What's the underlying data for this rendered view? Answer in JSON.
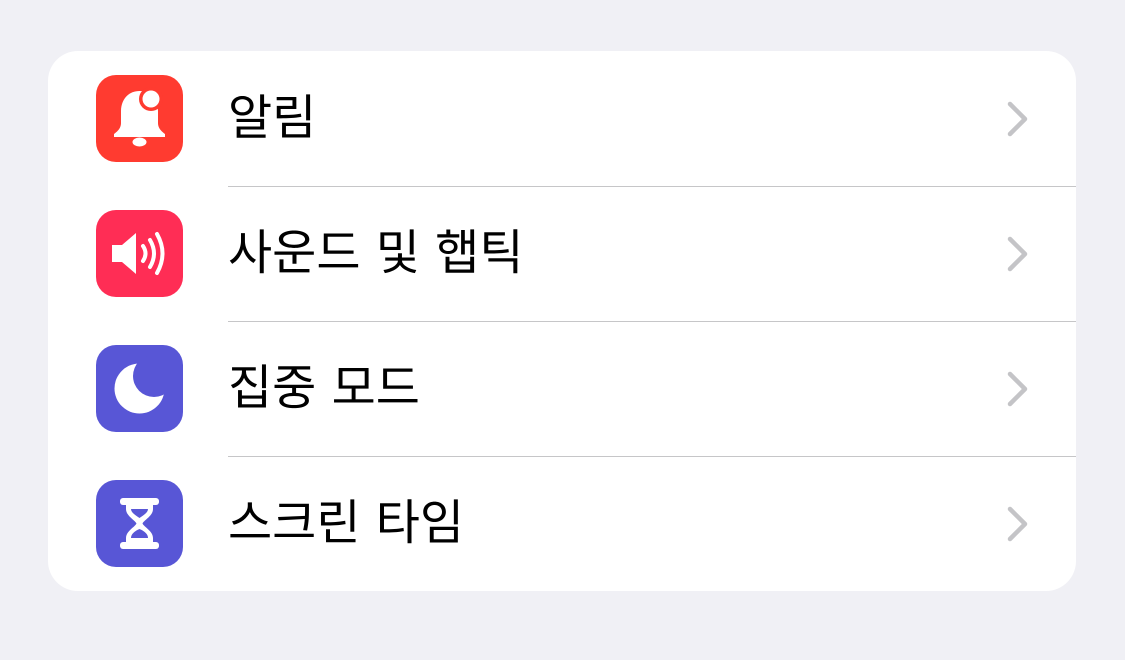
{
  "settings_group": {
    "items": [
      {
        "label": "알림",
        "icon": "bell-badge-icon",
        "color": "#ff3b30"
      },
      {
        "label": "사운드 및 햅틱",
        "icon": "speaker-wave-icon",
        "color": "#ff2d55"
      },
      {
        "label": "집중 모드",
        "icon": "moon-icon",
        "color": "#5856d6"
      },
      {
        "label": "스크린 타임",
        "icon": "hourglass-icon",
        "color": "#5856d6"
      }
    ]
  },
  "colors": {
    "background": "#f0f0f5",
    "card": "#ffffff",
    "separator": "#c6c6c8",
    "chevron": "#c4c4c7"
  }
}
